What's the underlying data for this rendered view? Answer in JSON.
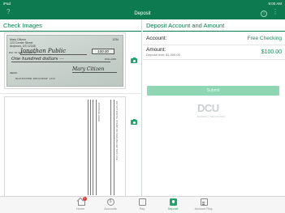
{
  "status_bar": {
    "carrier": "iPad",
    "time": "9:00 AM",
    "battery_pct": "91%"
  },
  "nav": {
    "title": "Deposit",
    "help_icon": "help-icon",
    "info_icon": "info-icon",
    "more_icon": "more-icon",
    "help_glyph": "?",
    "info_glyph": "i",
    "more_glyph": "⋮"
  },
  "left_panel": {
    "title": "Check Images",
    "check_front": {
      "drawer_name": "Mary Citizen",
      "drawer_addr1": "123 Center Street",
      "drawer_addr2": "Anytown, US 12345",
      "check_number": "1234",
      "pay_to_label": "PAY TO THE ORDER OF",
      "payee": "Jonathan Public",
      "amount_box": "100.00",
      "amount_words": "One hundred dollars —",
      "dollars_label": "DOLLARS",
      "memo_label": "MEMO",
      "signature": "Mary Citizen",
      "micr": "⑆123456789⑆ 000123456⑈ 1234"
    },
    "check_back": {
      "endorse_text_1": "ENDORSE HERE",
      "endorse_text_2": "DO NOT WRITE, STAMP OR SIGN BELOW THIS LINE"
    }
  },
  "right_panel": {
    "title": "Deposit Account and Amount",
    "account_label": "Account:",
    "account_value": "Free Checking",
    "amount_label": "Amount:",
    "deposit_limit": "Deposit limit: $1,000.00",
    "amount_value": "$100.00",
    "submit_label": "Submit",
    "logo_text": "DCU",
    "logo_tagline": "BANKING • THE DCU WAY"
  },
  "tab_bar": {
    "tabs": [
      {
        "label": "Home",
        "icon": "home-icon",
        "badge": "1"
      },
      {
        "label": "Accounts",
        "icon": "accounts-icon",
        "glyph": "$"
      },
      {
        "label": "Pay",
        "icon": "pay-icon"
      },
      {
        "label": "Deposit",
        "icon": "deposit-icon",
        "active": true
      },
      {
        "label": "Account Reg.",
        "icon": "register-icon"
      }
    ]
  },
  "colors": {
    "brand_green": "#0e7a4f",
    "accent_green": "#21a36b",
    "submit_disabled": "#8fd6b5"
  }
}
